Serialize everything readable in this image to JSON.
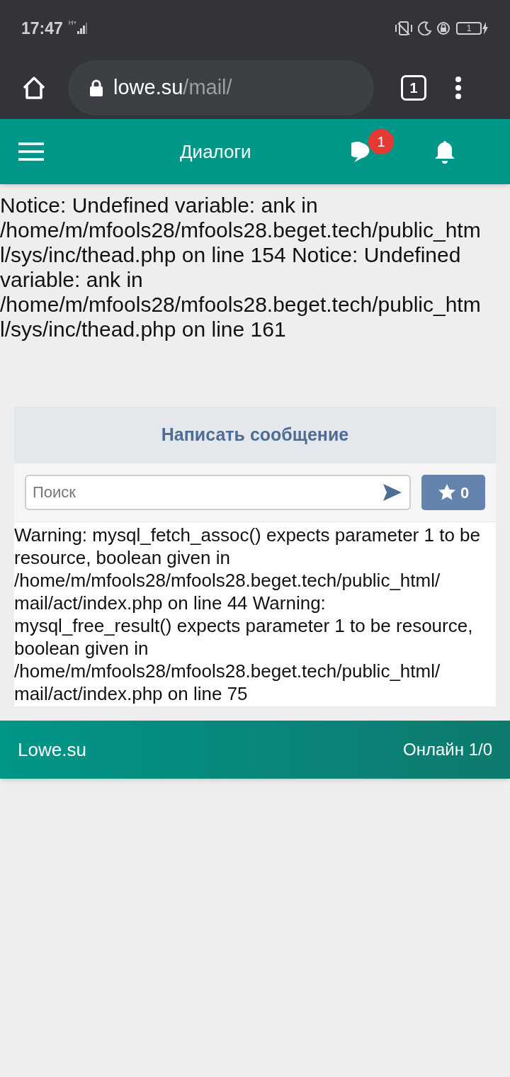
{
  "status_bar": {
    "time": "17:47",
    "network": "H+",
    "battery": "1"
  },
  "browser": {
    "domain": "lowe.su",
    "path": "/mail/",
    "tab_count": "1"
  },
  "header": {
    "title": "Диалоги",
    "messages_badge": "1"
  },
  "notice_lines": [
    "Notice: Undefined variable: ank in",
    "/home/m/mfools28/mfools28.beget.tech/public_htm",
    "l/sys/inc/thead.php on line 154 Notice: Undefined",
    "variable: ank in",
    "/home/m/mfools28/mfools28.beget.tech/public_htm",
    "l/sys/inc/thead.php on line 161"
  ],
  "card": {
    "title": "Написать сообщение",
    "search": {
      "placeholder": "Поиск"
    },
    "favorites_count": "0",
    "warning_lines": [
      "Warning: mysql_fetch_assoc() expects parameter 1 to be",
      "resource, boolean given in",
      "/home/m/mfools28/mfools28.beget.tech/public_html/",
      "mail/act/index.php on line 44 Warning:",
      "mysql_free_result() expects parameter 1 to be resource,",
      "boolean given in",
      "/home/m/mfools28/mfools28.beget.tech/public_html/",
      "mail/act/index.php on line 75"
    ]
  },
  "footer": {
    "site": "Lowe.su",
    "online": "Онлайн 1/0"
  }
}
